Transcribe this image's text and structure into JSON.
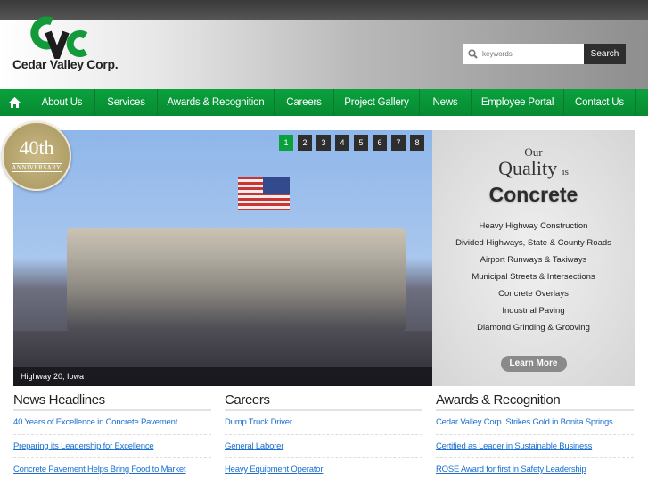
{
  "header": {
    "logo_text": "Cedar Valley Corp.",
    "logo_monogram": "CVC",
    "search_placeholder": "keywords",
    "search_button": "Search"
  },
  "nav": {
    "home_icon": "home-icon",
    "items": [
      "About Us",
      "Services",
      "Awards & Recognition",
      "Careers",
      "Project Gallery",
      "News",
      "Employee Portal",
      "Contact Us"
    ]
  },
  "badge": {
    "big": "40th",
    "small": "ANNIVERSARY"
  },
  "slider": {
    "caption": "Highway 20, Iowa",
    "pages": [
      "1",
      "2",
      "3",
      "4",
      "5",
      "6",
      "7",
      "8"
    ],
    "active_page": "1"
  },
  "panel": {
    "line1": "Our",
    "line2": "Quality",
    "line2b": "is",
    "line3": "Concrete",
    "services": [
      "Heavy Highway Construction",
      "Divided Highways, State & County Roads",
      "Airport Runways & Taxiways",
      "Municipal Streets & Intersections",
      "Concrete Overlays",
      "Industrial Paving",
      "Diamond Grinding & Grooving"
    ],
    "button": "Learn More"
  },
  "columns": [
    {
      "title": "News Headlines",
      "links": [
        "40 Years of Excellence in Concrete Pavement",
        "Preparing its Leadership for Excellence",
        "Concrete Pavement Helps Bring Food to Market"
      ]
    },
    {
      "title": "Careers",
      "links": [
        "Dump Truck Driver",
        "General Laborer",
        "Heavy Equipment Operator"
      ]
    },
    {
      "title": "Awards & Recognition",
      "links": [
        "Cedar Valley Corp. Strikes Gold in Bonita Springs",
        "Certified as Leader in Sustainable Business",
        "ROSE Award for first in Safety Leadership"
      ]
    }
  ],
  "colors": {
    "brand_green": "#0aa13d",
    "link": "#1a6fd1"
  }
}
